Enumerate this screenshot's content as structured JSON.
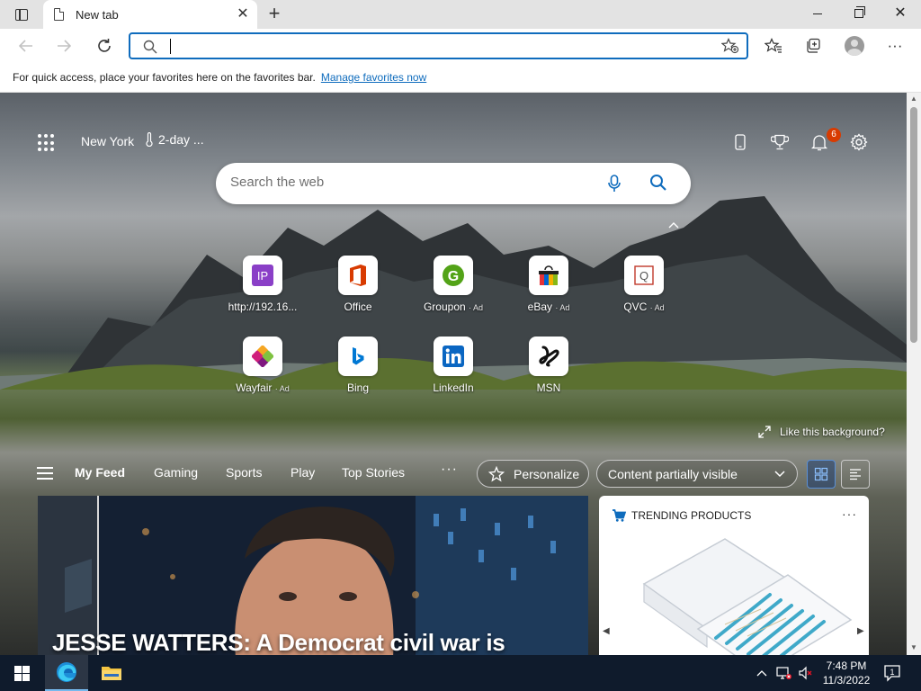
{
  "browser": {
    "tab_title": "New tab",
    "address_value": "",
    "favbar_text": "For quick access, place your favorites here on the favorites bar.",
    "favbar_link": "Manage favorites now"
  },
  "header": {
    "location": "New York",
    "weather": "2-day ...",
    "notification_count": "6"
  },
  "search": {
    "placeholder": "Search the web"
  },
  "quick_links": [
    {
      "label": "http://192.16...",
      "ad": "",
      "icon": "ip-icon",
      "color": "#8a3fc7"
    },
    {
      "label": "Office",
      "ad": "",
      "icon": "office-icon",
      "color": "#d83b01"
    },
    {
      "label": "Groupon",
      "ad": "· Ad",
      "icon": "groupon-icon",
      "color": "#53a318"
    },
    {
      "label": "eBay",
      "ad": "· Ad",
      "icon": "ebay-icon",
      "color": "#e53238"
    },
    {
      "label": "QVC",
      "ad": "· Ad",
      "icon": "qvc-icon",
      "color": "#c0392b"
    },
    {
      "label": "Wayfair",
      "ad": "· Ad",
      "icon": "wayfair-icon",
      "color": "#7f187f"
    },
    {
      "label": "Bing",
      "ad": "",
      "icon": "bing-icon",
      "color": "#0078d4"
    },
    {
      "label": "LinkedIn",
      "ad": "",
      "icon": "linkedin-icon",
      "color": "#0a66c2"
    },
    {
      "label": "MSN",
      "ad": "",
      "icon": "msn-icon",
      "color": "#000000"
    }
  ],
  "like_background": "Like this background?",
  "feed": {
    "tabs": [
      "My Feed",
      "Gaming",
      "Sports",
      "Play",
      "Top Stories"
    ],
    "more": "···",
    "personalize": "Personalize",
    "content_visibility": "Content partially visible"
  },
  "cards": {
    "hero_headline": "JESSE WATTERS: A Democrat civil war is",
    "trending_title": "TRENDING PRODUCTS",
    "trending_more": "···"
  },
  "taskbar": {
    "time": "7:48 PM",
    "date": "11/3/2022",
    "notification_count": "1"
  },
  "colors": {
    "accent": "#0f6cbd",
    "badge": "#d83b01",
    "taskbar": "#0f1b2c"
  }
}
